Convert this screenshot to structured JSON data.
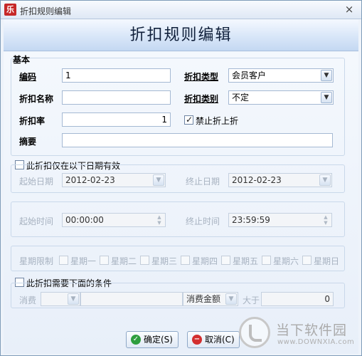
{
  "window": {
    "app_icon": "乐",
    "title": "折扣规则编辑",
    "close_glyph": "×"
  },
  "banner": {
    "title": "折扣规则编辑"
  },
  "basic": {
    "group_title": "基本",
    "code_label": "编码",
    "code_value": "1",
    "name_label": "折扣名称",
    "name_value": "",
    "rate_label": "折扣率",
    "rate_value": "1",
    "summary_label": "摘要",
    "summary_value": "",
    "type_label": "折扣类型",
    "type_value": "会员客户",
    "category_label": "折扣类别",
    "category_value": "不定",
    "forbid_label": "禁止折上折",
    "forbid_checked": true
  },
  "date_range": {
    "check_label": "此折扣仅在以下日期有效",
    "start_date_label": "起始日期",
    "start_date_value": "2012-02-23",
    "end_date_label": "终止日期",
    "end_date_value": "2012-02-23"
  },
  "time_range": {
    "start_time_label": "起始时间",
    "start_time_value": "00:00:00",
    "end_time_label": "终止时间",
    "end_time_value": "23:59:59"
  },
  "weekdays": {
    "label": "星期限制",
    "days": [
      "星期一",
      "星期二",
      "星期三",
      "星期四",
      "星期五",
      "星期六",
      "星期日"
    ]
  },
  "conditions": {
    "check_label": "此折扣需要下面的条件",
    "consume_label": "消费",
    "consume_value": "",
    "amount_field": "消费金额",
    "compare": "大于",
    "amount_value": "0"
  },
  "buttons": {
    "ok_label": "确定(S)",
    "cancel_label": "取消(C)"
  },
  "watermark": {
    "cn": "当下软件园",
    "en": "www.DOWNXIA.com"
  },
  "colors": {
    "banner_top": "#f4f8ff",
    "banner_bottom": "#c4d8f2",
    "body_bg": "#eef3fa",
    "ok_icon": "#2e9e3e",
    "cancel_icon": "#d32f2f"
  }
}
